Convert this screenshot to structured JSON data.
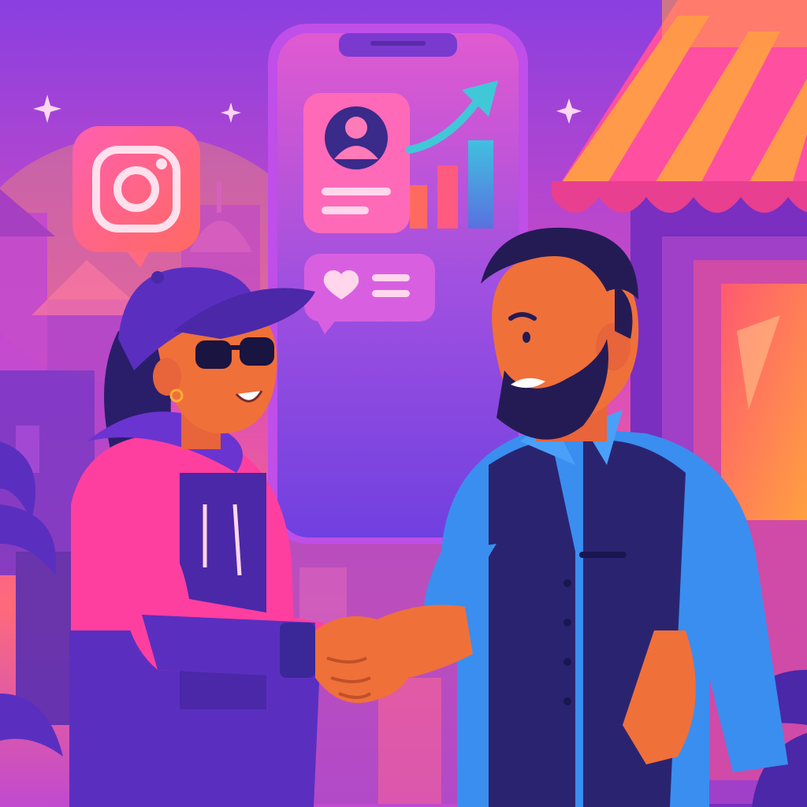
{
  "scene": {
    "title": "",
    "description_visible_text": []
  },
  "colors": {
    "sky_top": "#8a3fe0",
    "sky_mid": "#d84cc0",
    "sky_bottom": "#ff6a7a",
    "glow": "#ff9a5a",
    "phone_body": "#b44ce0",
    "phone_screen_top": "#d35ad8",
    "phone_screen_bottom": "#7a4ce8",
    "instagram_tile": "#ff5fa0",
    "awning_pink": "#ff4fa0",
    "awning_orange": "#ff9a4a",
    "hoodie_pink": "#ff3fa0",
    "hoodie_purple": "#5a2fc0",
    "cap": "#5a2fc0",
    "skin": "#f0703a",
    "shirt_blue": "#3a8ef0",
    "vest": "#2a2470",
    "hair": "#241b55"
  },
  "icons": {
    "app_icon": "instagram-icon",
    "profile_card": "profile-card-icon",
    "growth_chart": "growth-chart-icon",
    "like_bubble": "heart-comment-icon",
    "sparkles": "sparkle-icon"
  },
  "growth_chart": {
    "bars": [
      0.4,
      0.62,
      0.9
    ],
    "trend": "up"
  }
}
